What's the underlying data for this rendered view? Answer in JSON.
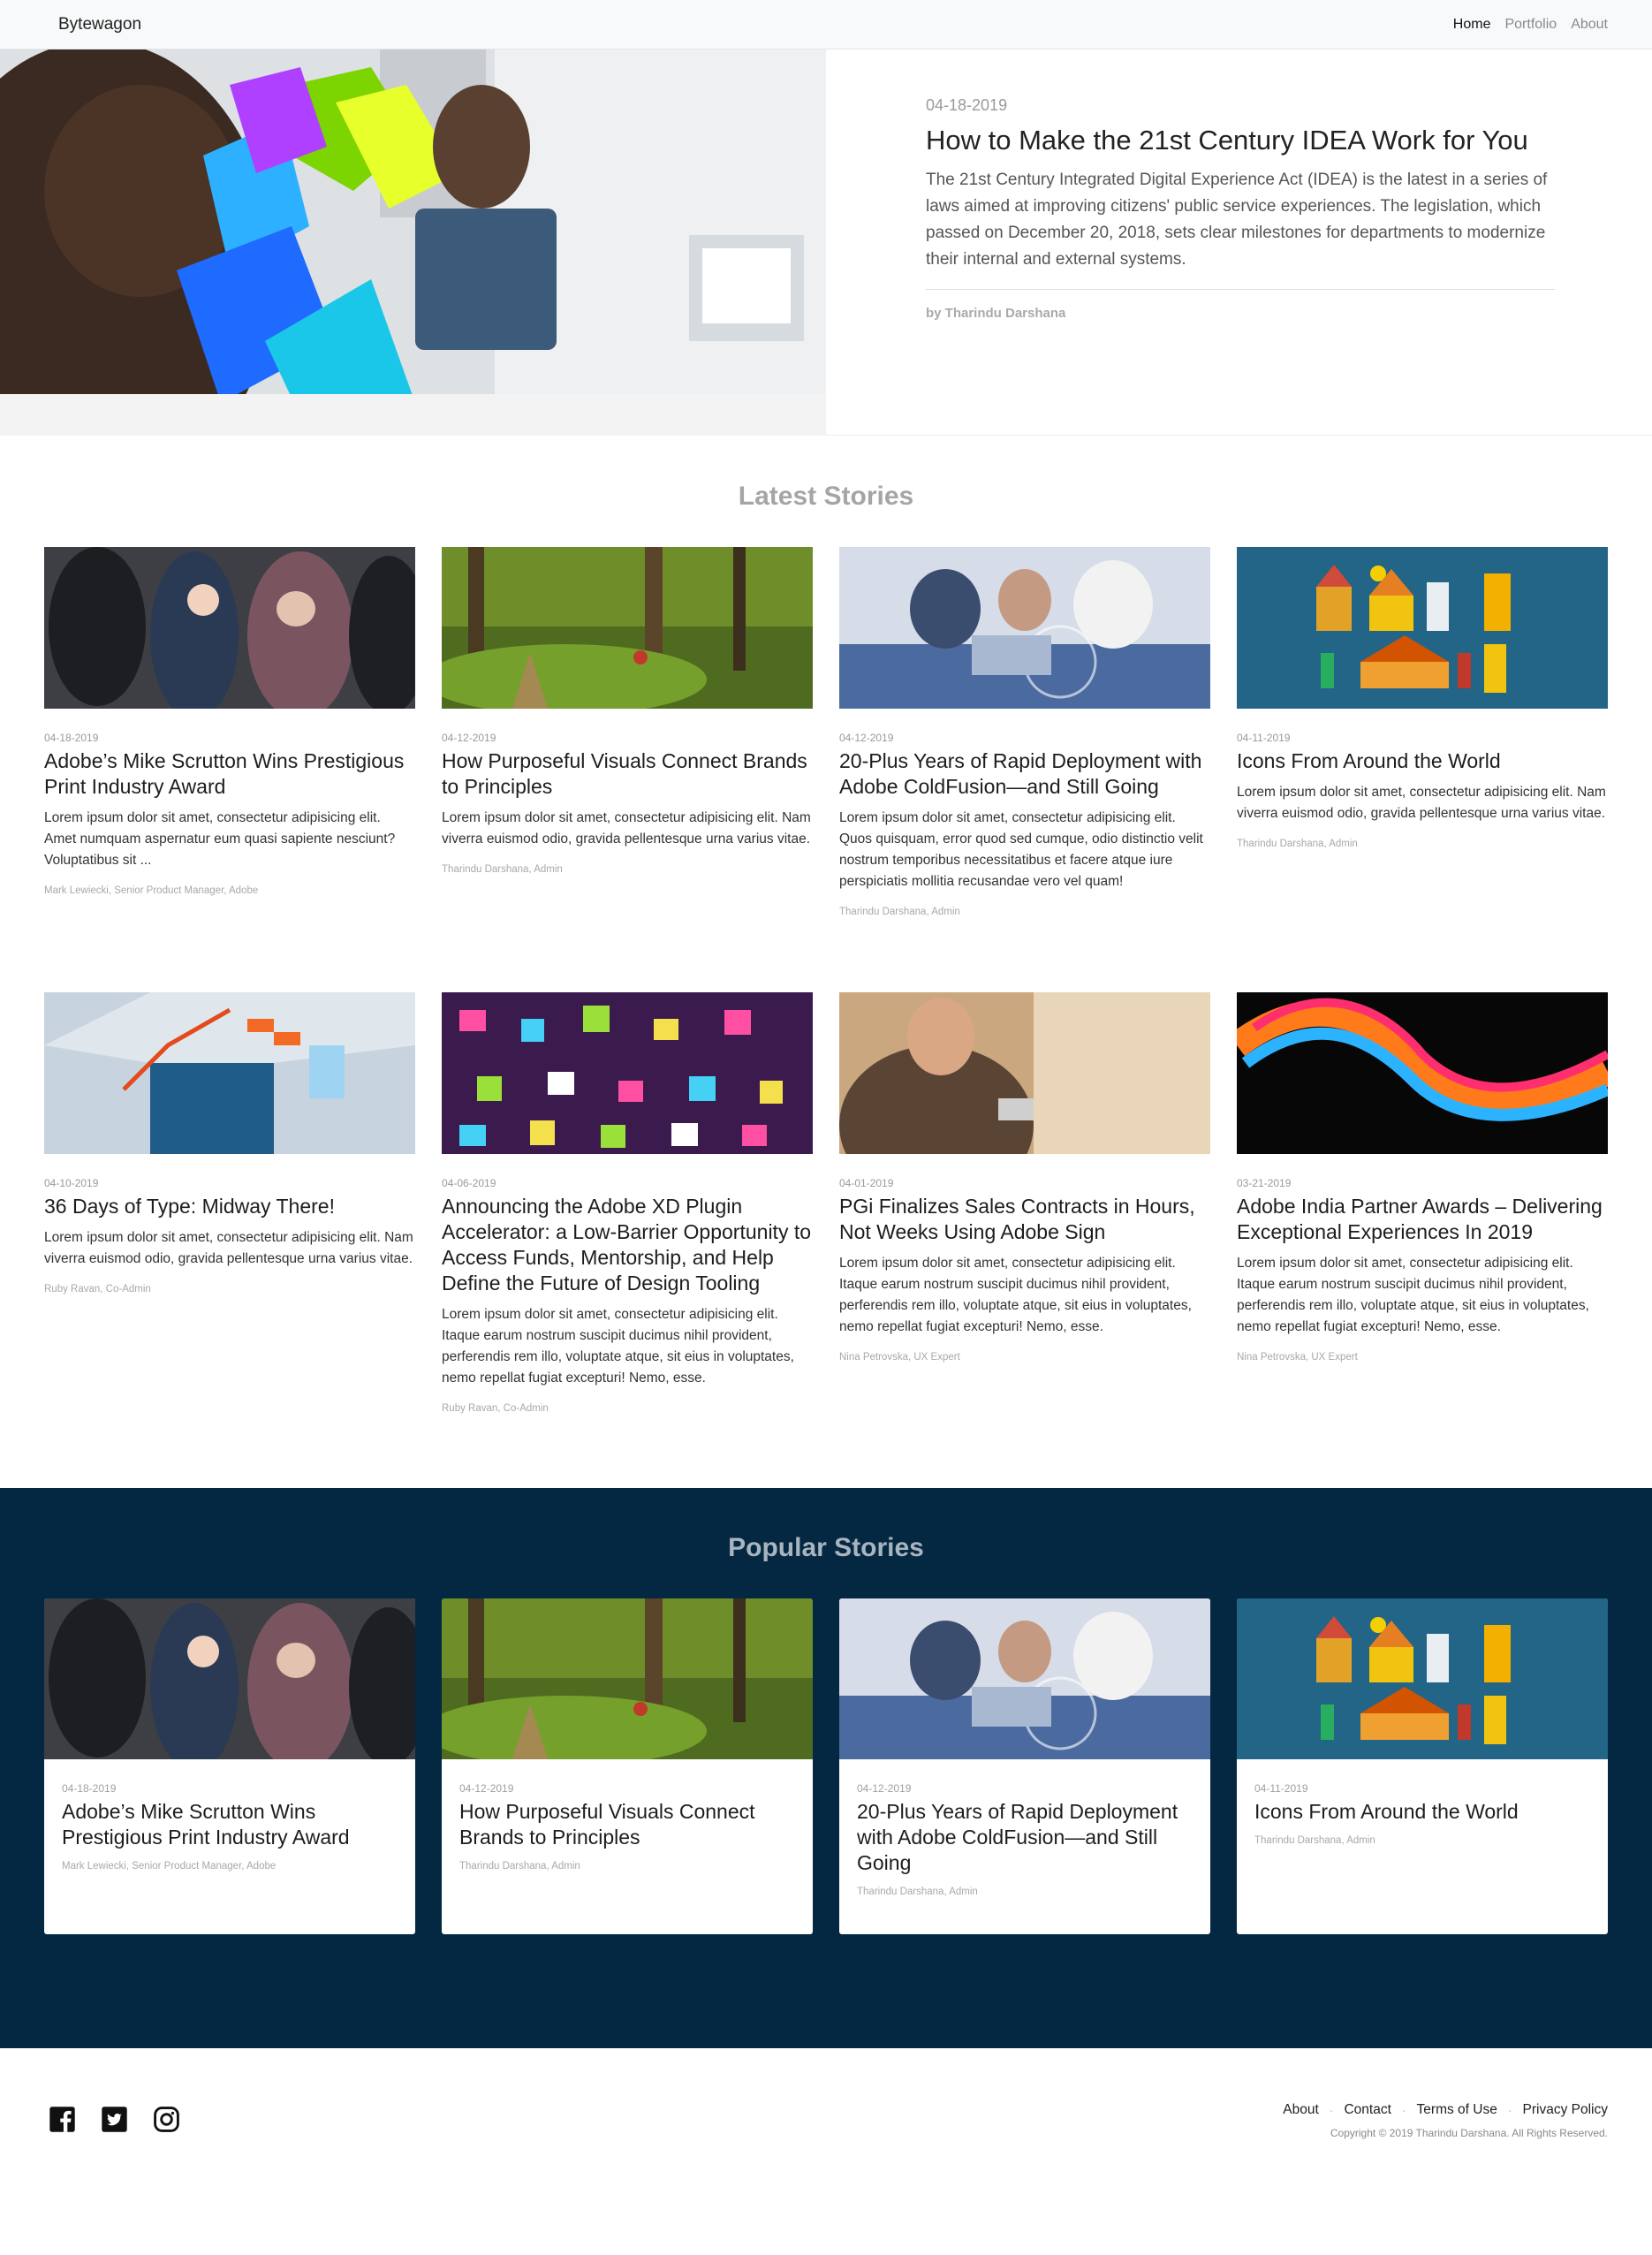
{
  "nav": {
    "brand": "Bytewagon",
    "links": [
      "Home",
      "Portfolio",
      "About"
    ]
  },
  "hero": {
    "date": "04-18-2019",
    "title": "How to Make the 21st Century IDEA Work for You",
    "excerpt": "The 21st Century Integrated Digital Experience Act (IDEA) is the latest in a series of laws aimed at improving citizens' public service experiences. The legislation, which passed on December 20, 2018, sets clear milestones for departments to modernize their internal and external systems.",
    "author": "by Tharindu Darshana"
  },
  "latest": {
    "title": "Latest Stories",
    "stories": [
      {
        "date": "04-18-2019",
        "title": "Adobe’s Mike Scrutton Wins Prestigious Print Industry Award",
        "excerpt": "Lorem ipsum dolor sit amet, consectetur adipisicing elit. Amet numquam aspernatur eum quasi sapiente nesciunt? Voluptatibus sit ...",
        "author": "Mark Lewiecki, Senior Product Manager, Adobe"
      },
      {
        "date": "04-12-2019",
        "title": "How Purposeful Visuals Connect Brands to Principles",
        "excerpt": "Lorem ipsum dolor sit amet, consectetur adipisicing elit. Nam viverra euismod odio, gravida pellentesque urna varius vitae.",
        "author": "Tharindu Darshana, Admin"
      },
      {
        "date": "04-12-2019",
        "title": "20-Plus Years of Rapid Deployment with Adobe ColdFusion—and Still Going",
        "excerpt": "Lorem ipsum dolor sit amet, consectetur adipisicing elit. Quos quisquam, error quod sed cumque, odio distinctio velit nostrum temporibus necessitatibus et facere atque iure perspiciatis mollitia recusandae vero vel quam!",
        "author": "Tharindu Darshana, Admin"
      },
      {
        "date": "04-11-2019",
        "title": "Icons From Around the World",
        "excerpt": "Lorem ipsum dolor sit amet, consectetur adipisicing elit. Nam viverra euismod odio, gravida pellentesque urna varius vitae.",
        "author": "Tharindu Darshana, Admin"
      },
      {
        "date": "04-10-2019",
        "title": "36 Days of Type: Midway There!",
        "excerpt": "Lorem ipsum dolor sit amet, consectetur adipisicing elit. Nam viverra euismod odio, gravida pellentesque urna varius vitae.",
        "author": "Ruby Ravan, Co-Admin"
      },
      {
        "date": "04-06-2019",
        "title": "Announcing the Adobe XD Plugin Accelerator: a Low-Barrier Opportunity to Access Funds, Mentorship, and Help Define the Future of Design Tooling",
        "excerpt": "Lorem ipsum dolor sit amet, consectetur adipisicing elit. Itaque earum nostrum suscipit ducimus nihil provident, perferendis rem illo, voluptate atque, sit eius in voluptates, nemo repellat fugiat excepturi! Nemo, esse.",
        "author": "Ruby Ravan, Co-Admin"
      },
      {
        "date": "04-01-2019",
        "title": "PGi Finalizes Sales Contracts in Hours, Not Weeks Using Adobe Sign",
        "excerpt": "Lorem ipsum dolor sit amet, consectetur adipisicing elit. Itaque earum nostrum suscipit ducimus nihil provident, perferendis rem illo, voluptate atque, sit eius in voluptates, nemo repellat fugiat excepturi! Nemo, esse.",
        "author": "Nina Petrovska, UX Expert"
      },
      {
        "date": "03-21-2019",
        "title": "Adobe India Partner Awards – Delivering Exceptional Experiences In 2019",
        "excerpt": "Lorem ipsum dolor sit amet, consectetur adipisicing elit. Itaque earum nostrum suscipit ducimus nihil provident, perferendis rem illo, voluptate atque, sit eius in voluptates, nemo repellat fugiat excepturi! Nemo, esse.",
        "author": "Nina Petrovska, UX Expert"
      }
    ]
  },
  "popular": {
    "title": "Popular Stories",
    "stories": [
      {
        "date": "04-18-2019",
        "title": "Adobe’s Mike Scrutton Wins Prestigious Print Industry Award",
        "author": "Mark Lewiecki, Senior Product Manager, Adobe"
      },
      {
        "date": "04-12-2019",
        "title": "How Purposeful Visuals Connect Brands to Principles",
        "author": "Tharindu Darshana, Admin"
      },
      {
        "date": "04-12-2019",
        "title": "20-Plus Years of Rapid Deployment with Adobe ColdFusion—and Still Going",
        "author": "Tharindu Darshana, Admin"
      },
      {
        "date": "04-11-2019",
        "title": "Icons From Around the World",
        "author": "Tharindu Darshana, Admin"
      }
    ]
  },
  "footer": {
    "social": [
      "facebook-icon",
      "twitter-icon",
      "instagram-icon"
    ],
    "links": [
      "About",
      "Contact",
      "Terms of Use",
      "Privacy Policy"
    ],
    "copyright": "Copyright © 2019 Tharindu Darshana. All Rights Reserved."
  },
  "colors": {
    "popular_bg": "#052842",
    "section_title": "#a5a5a5",
    "nav_bg": "#f8f9fa"
  }
}
